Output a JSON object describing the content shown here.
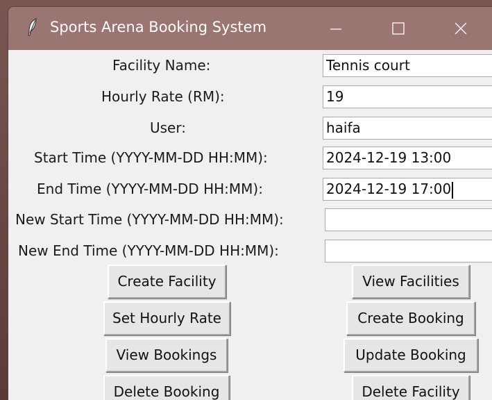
{
  "window": {
    "title": "Sports Arena Booking System",
    "minimize_glyph": "—",
    "maximize_glyph": "☐",
    "close_glyph": "✕"
  },
  "form": {
    "facility_name": {
      "label": "Facility Name:",
      "value": "Tennis court"
    },
    "hourly_rate": {
      "label": "Hourly Rate (RM):",
      "value": "19"
    },
    "user": {
      "label": "User:",
      "value": "haifa"
    },
    "start_time": {
      "label": "Start Time (YYYY-MM-DD HH:MM):",
      "value": "2024-12-19 13:00"
    },
    "end_time": {
      "label": "End Time (YYYY-MM-DD HH:MM):",
      "value": "2024-12-19 17:00"
    },
    "new_start_time": {
      "label": "New Start Time (YYYY-MM-DD HH:MM):",
      "value": ""
    },
    "new_end_time": {
      "label": "New End Time (YYYY-MM-DD HH:MM):",
      "value": ""
    }
  },
  "buttons": {
    "create_facility": "Create Facility",
    "view_facilities": "View Facilities",
    "set_hourly_rate": "Set Hourly Rate",
    "create_booking": "Create Booking",
    "view_bookings": "View Bookings",
    "update_booking": "Update Booking",
    "delete_booking": "Delete Booking",
    "delete_facility": "Delete Facility"
  },
  "colors": {
    "titlebar": "#9a7571",
    "window_bg": "#f0f0f0"
  },
  "icons": {
    "app": "feather-icon",
    "minimize": "minimize-icon",
    "maximize": "maximize-icon",
    "close": "close-icon"
  }
}
